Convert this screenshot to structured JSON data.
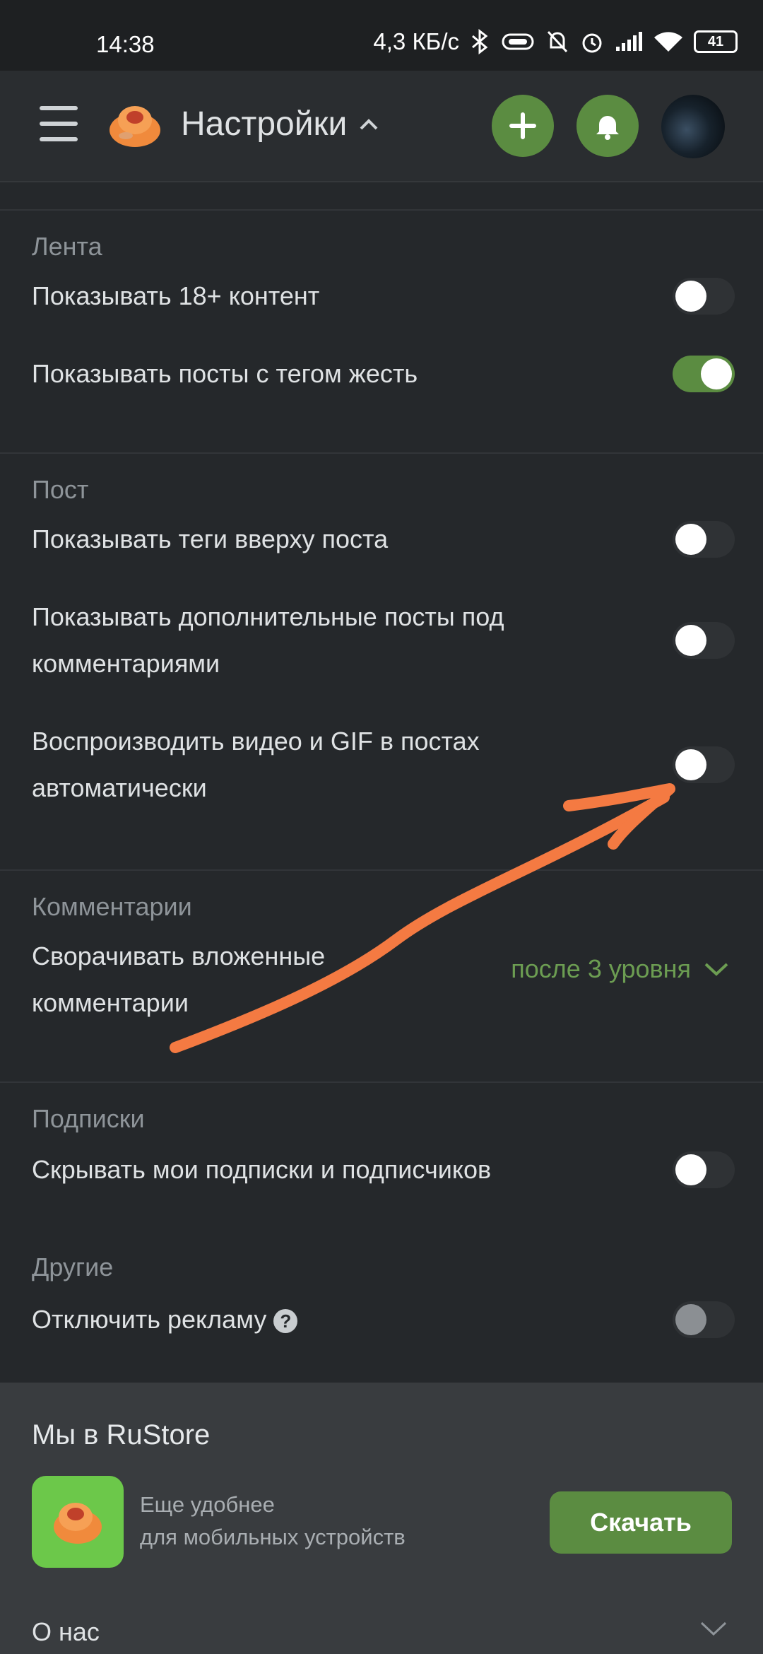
{
  "status_bar": {
    "time": "14:38",
    "speed": "4,3 КБ/с",
    "battery": "41"
  },
  "header": {
    "title": "Настройки"
  },
  "sections": [
    {
      "title": "Лента",
      "rows": [
        {
          "label": "Показывать 18+ контент",
          "toggle_on": false
        },
        {
          "label": "Показывать посты с тегом жесть",
          "toggle_on": true
        }
      ]
    },
    {
      "title": "Пост",
      "rows": [
        {
          "label": "Показывать теги вверху поста",
          "toggle_on": false
        },
        {
          "label": "Показывать дополнительные посты под комментариями",
          "toggle_on": false
        },
        {
          "label": "Воспроизводить видео и GIF в постах автоматически",
          "toggle_on": false
        }
      ]
    },
    {
      "title": "Комментарии",
      "rows": [
        {
          "label": "Сворачивать вложенные комментарии",
          "select_value": "после 3 уровня"
        }
      ]
    },
    {
      "title": "Подписки",
      "rows": [
        {
          "label": "Скрывать мои подписки и подписчиков",
          "toggle_on": false
        }
      ]
    },
    {
      "title": "Другие",
      "rows": [
        {
          "label": "Отключить рекламу",
          "toggle_on": false,
          "disabled": true
        }
      ]
    }
  ],
  "footer": {
    "rustore_title": "Мы в RuStore",
    "rustore_line1": "Еще удобнее",
    "rustore_line2": "для мобильных устройств",
    "download_label": "Скачать",
    "about_label": "О нас"
  },
  "colors": {
    "accent": "#5b8c41",
    "annotation": "#f47a42",
    "background": "#25282b"
  }
}
